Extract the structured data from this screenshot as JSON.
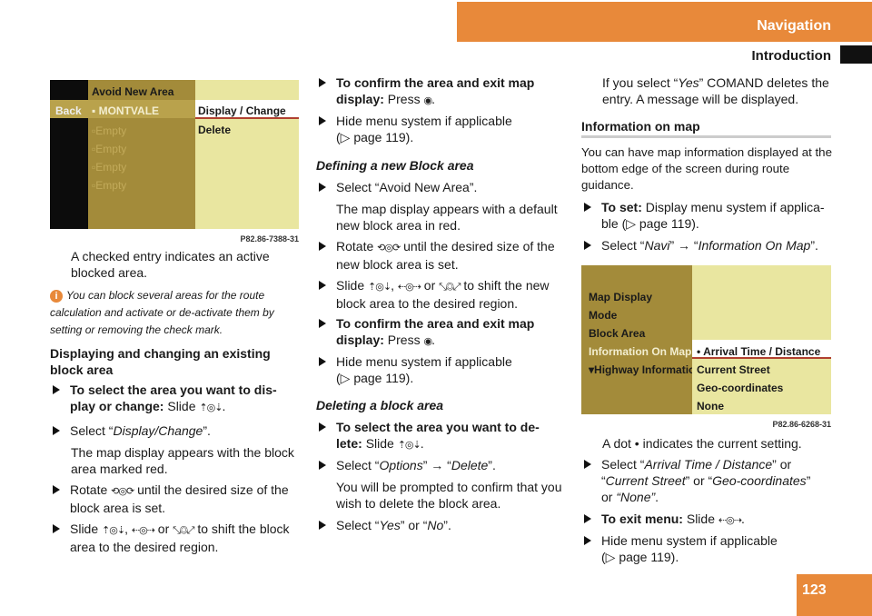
{
  "header": {
    "section": "Navigation",
    "subsection": "Introduction",
    "page_number": "123",
    "accent": "#e8893a"
  },
  "screen1": {
    "title": "Avoid New Area",
    "back": "Back",
    "selected": "MONTVALE",
    "items": [
      "Empty",
      "Empty",
      "Empty",
      "Empty"
    ],
    "options": [
      "Display / Change",
      "Delete"
    ],
    "caption": "P82.86-7388-31"
  },
  "screen2": {
    "menu": [
      "Map Display",
      "Mode",
      "Block Area",
      "Information On Map",
      "Highway Information"
    ],
    "options": [
      "• Arrival Time / Distance",
      "Current Street",
      "Geo-coordinates",
      "None"
    ],
    "caption": "P82.86-6268-31"
  },
  "col1": {
    "checked": "A checked entry indicates an active blocked area.",
    "note": "You can block several areas for the route calculation and activate or de-activate them by setting or removing the check mark.",
    "heading": "Displaying and changing an existing block area",
    "s1_lead": "To select the area you want to dis-play or change:",
    "s1_text": "Slide",
    "s2_a": "Select “",
    "s2_i": "Display/Change",
    "s2_b": "”.",
    "s2_note": "The map display appears with the block area marked red.",
    "s3_a": "Rotate",
    "s3_b": "until the desired size of the block area is set.",
    "s4_a": "Slide",
    "s4_b": ",",
    "s4_c": "or",
    "s4_d": "to shift the block area to the desired region."
  },
  "col2": {
    "c1_lead": "To confirm the area and exit map display:",
    "c1_text": "Press",
    "hide": "Hide menu system if applicable (▷ page 119).",
    "heading1": "Defining a new Block area",
    "d1": "Select “Avoid New Area”.",
    "d1_note": "The map display appears with a default new block area in red.",
    "d2_a": "Rotate",
    "d2_b": "until the desired size of the new block area is set.",
    "d3_a": "Slide",
    "d3_b": ",",
    "d3_c": "or",
    "d3_d": "to shift the new block area to the desired region.",
    "heading2": "Deleting a block area",
    "e1_lead": "To select the area you want to de-lete:",
    "e1_text": "Slide",
    "e2_a": "Select “",
    "e2_i1": "Options",
    "e2_b": "” → “",
    "e2_i2": "Delete",
    "e2_c": "”.",
    "e2_note": "You will be prompted to confirm that you wish to delete the block area.",
    "e3_a": "Select “",
    "e3_i1": "Yes",
    "e3_b": "” or “",
    "e3_i2": "No",
    "e3_c": "”."
  },
  "col3": {
    "yes_a": "If you select “",
    "yes_i": "Yes",
    "yes_b": "” COMAND deletes the entry. A message will be displayed.",
    "heading": "Information on map",
    "para": "You can have map information displayed at the bottom edge of the screen during route guidance.",
    "set_lead": "To set:",
    "set_text": "Display menu system if applica-ble (▷ page 119).",
    "sel_a": "Select “",
    "sel_i1": "Navi",
    "sel_b": "” → “",
    "sel_i2": "Information On Map",
    "sel_c": "”.",
    "dot": "A dot • indicates the current setting.",
    "opt_a": "Select “",
    "opt_i1": "Arrival Time / Distance",
    "opt_b": "” or “",
    "opt_i2": "Current Street",
    "opt_c": "” or “",
    "opt_i3": "Geo-coordinates",
    "opt_d": "” or ",
    "opt_i4": "“None”",
    "opt_e": ".",
    "exit_lead": "To exit menu:",
    "exit_text": "Slide",
    "hide": "Hide menu system if applicable (▷ page 119)."
  },
  "icons": {
    "slide_vertical": "⇡◎⇣",
    "slide_horizontal": "⇠◎⇢",
    "slide_diagonal": "⤡◎⤢",
    "rotate": "⟲◎⟳",
    "press": "◉"
  }
}
